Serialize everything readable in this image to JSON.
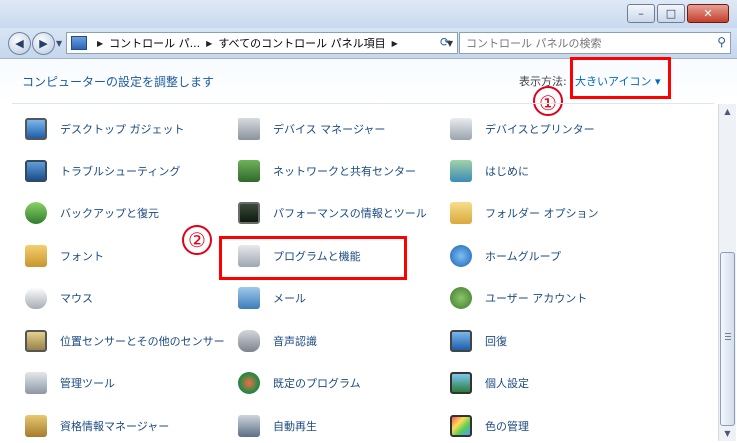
{
  "window": {
    "minimize": "–",
    "maximize": "□",
    "close": "✕"
  },
  "nav": {
    "back": "◀",
    "forward": "▶",
    "breadcrumb": [
      "コントロール パ...",
      "すべてのコントロール パネル項目"
    ],
    "search_placeholder": "コントロール パネルの検索"
  },
  "header": {
    "title": "コンピューターの設定を調整します",
    "view_label": "表示方法:",
    "view_value": "大きいアイコン ▾"
  },
  "annotations": {
    "one": "①",
    "two": "②"
  },
  "items": [
    {
      "label": "デスクトップ ガジェット",
      "icon": "desktop-gadgets-icon"
    },
    {
      "label": "デバイス マネージャー",
      "icon": "device-manager-icon"
    },
    {
      "label": "デバイスとプリンター",
      "icon": "devices-printers-icon"
    },
    {
      "label": "トラブルシューティング",
      "icon": "troubleshooting-icon"
    },
    {
      "label": "ネットワークと共有センター",
      "icon": "network-sharing-icon"
    },
    {
      "label": "はじめに",
      "icon": "getting-started-icon"
    },
    {
      "label": "バックアップと復元",
      "icon": "backup-restore-icon"
    },
    {
      "label": "パフォーマンスの情報とツール",
      "icon": "performance-icon"
    },
    {
      "label": "フォルダー オプション",
      "icon": "folder-options-icon"
    },
    {
      "label": "フォント",
      "icon": "fonts-icon"
    },
    {
      "label": "プログラムと機能",
      "icon": "programs-features-icon"
    },
    {
      "label": "ホームグループ",
      "icon": "homegroup-icon"
    },
    {
      "label": "マウス",
      "icon": "mouse-icon"
    },
    {
      "label": "メール",
      "icon": "mail-icon"
    },
    {
      "label": "ユーザー アカウント",
      "icon": "user-accounts-icon"
    },
    {
      "label": "位置センサーとその他のセンサー",
      "icon": "location-sensors-icon"
    },
    {
      "label": "音声認識",
      "icon": "speech-recognition-icon"
    },
    {
      "label": "回復",
      "icon": "recovery-icon"
    },
    {
      "label": "管理ツール",
      "icon": "admin-tools-icon"
    },
    {
      "label": "既定のプログラム",
      "icon": "default-programs-icon"
    },
    {
      "label": "個人設定",
      "icon": "personalization-icon"
    },
    {
      "label": "資格情報マネージャー",
      "icon": "credential-manager-icon"
    },
    {
      "label": "自動再生",
      "icon": "autoplay-icon"
    },
    {
      "label": "色の管理",
      "icon": "color-management-icon"
    }
  ]
}
